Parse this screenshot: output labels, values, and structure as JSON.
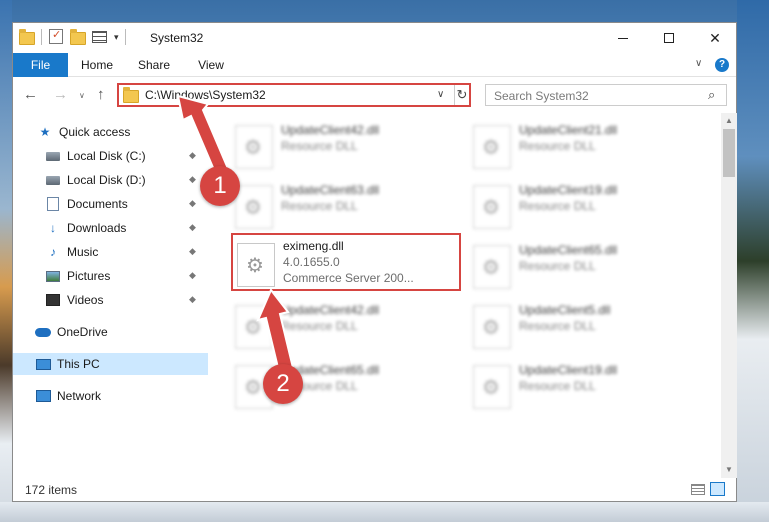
{
  "window": {
    "title": "System32",
    "minimize_symbol": "",
    "close_symbol": "✕"
  },
  "ribbon": {
    "tabs": [
      "File",
      "Home",
      "Share",
      "View"
    ],
    "expand_symbol": "∨",
    "help_symbol": "?"
  },
  "nav": {
    "back": "←",
    "forward": "→",
    "recent": "∨",
    "up": "↑",
    "address": "C:\\Windows\\System32",
    "address_dropdown": "∨",
    "refresh": "↻"
  },
  "search": {
    "placeholder": "Search System32",
    "icon": "⌕"
  },
  "navpane": {
    "items": [
      {
        "label": "Quick access",
        "icon": "star-icon",
        "pinned": false
      },
      {
        "label": "Local Disk (C:)",
        "icon": "drive-icon",
        "pinned": true
      },
      {
        "label": "Local Disk (D:)",
        "icon": "drive-icon",
        "pinned": true
      },
      {
        "label": "Documents",
        "icon": "documents-icon",
        "pinned": true
      },
      {
        "label": "Downloads",
        "icon": "download-icon",
        "pinned": true
      },
      {
        "label": "Music",
        "icon": "music-icon",
        "pinned": true
      },
      {
        "label": "Pictures",
        "icon": "pictures-icon",
        "pinned": true
      },
      {
        "label": "Videos",
        "icon": "videos-icon",
        "pinned": true
      },
      {
        "label": "OneDrive",
        "icon": "onedrive-icon",
        "pinned": false
      },
      {
        "label": "This PC",
        "icon": "pc-icon",
        "pinned": false,
        "selected": true
      },
      {
        "label": "Network",
        "icon": "network-icon",
        "pinned": false
      }
    ],
    "pin_symbol": "📌"
  },
  "files": {
    "left": [
      {
        "name": "UpdateClient42.dll",
        "desc": "Resource DLL"
      },
      {
        "name": "UpdateClient63.dll",
        "desc": "Resource DLL"
      },
      {
        "name": "eximeng.dll",
        "desc": "4.0.1655.0",
        "extra": "Commerce Server 200..."
      },
      {
        "name": "UpdateClient42.dll",
        "desc": "Resource DLL"
      },
      {
        "name": "UpdateClient65.dll",
        "desc": "Resource DLL"
      }
    ],
    "right": [
      {
        "name": "UpdateClient21.dll",
        "desc": "Resource DLL"
      },
      {
        "name": "UpdateClient19.dll",
        "desc": "Resource DLL"
      },
      {
        "name": "UpdateClient65.dll",
        "desc": "Resource DLL"
      },
      {
        "name": "UpdateClient5.dll",
        "desc": "Resource DLL"
      },
      {
        "name": "UpdateClient19.dll",
        "desc": "Resource DLL"
      }
    ]
  },
  "status": {
    "item_count": "172 items"
  },
  "annotations": {
    "step1": "1",
    "step2": "2",
    "color": "#d64541"
  },
  "scroll": {
    "up": "▲",
    "down": "▼"
  }
}
